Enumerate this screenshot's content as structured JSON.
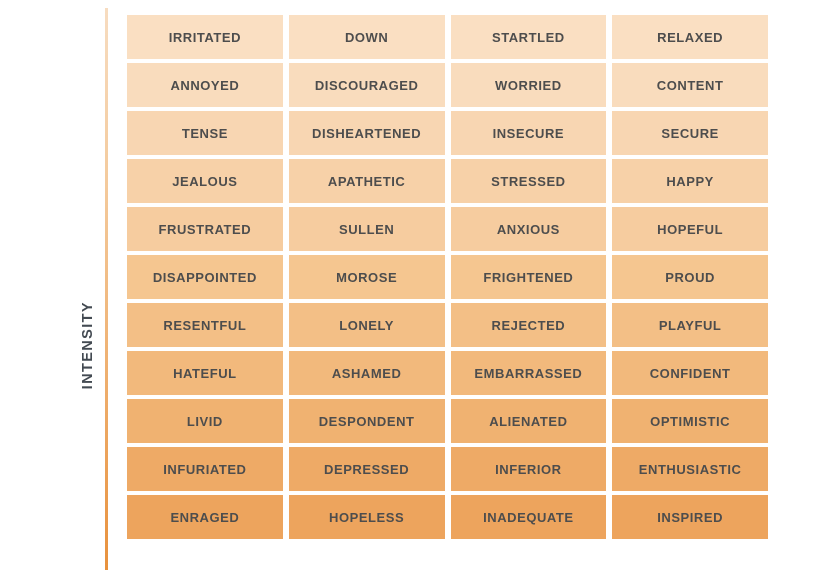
{
  "axis": {
    "label": "INTENSITY",
    "label_color": "#434a52",
    "line_top_color": "#f7dcc0",
    "line_bottom_color": "#e8913d"
  },
  "theme": {
    "text_color": "#4d4d4d",
    "background": "#ffffff"
  },
  "chart_data": {
    "type": "table",
    "title": "",
    "xlabel": "",
    "ylabel": "INTENSITY",
    "legend": [],
    "grid": false,
    "description": "Emotion intensity grid: four columns of feeling words ordered from lowest intensity (top, lightest shade) to highest intensity (bottom, most saturated orange).",
    "columns": 4,
    "rows": 11,
    "row_colors": [
      "#fadfc2",
      "#f9dcbd",
      "#f8d6b2",
      "#f7d1a8",
      "#f6cc9f",
      "#f5c690",
      "#f3bf86",
      "#f2b97c",
      "#f0b271",
      "#eeaa66",
      "#eda45d"
    ],
    "series": [
      {
        "name": "column-1",
        "values": [
          "IRRITATED",
          "ANNOYED",
          "TENSE",
          "JEALOUS",
          "FRUSTRATED",
          "DISAPPOINTED",
          "RESENTFUL",
          "HATEFUL",
          "LIVID",
          "INFURIATED",
          "ENRAGED"
        ]
      },
      {
        "name": "column-2",
        "values": [
          "DOWN",
          "DISCOURAGED",
          "DISHEARTENED",
          "APATHETIC",
          "SULLEN",
          "MOROSE",
          "LONELY",
          "ASHAMED",
          "DESPONDENT",
          "DEPRESSED",
          "HOPELESS"
        ]
      },
      {
        "name": "column-3",
        "values": [
          "STARTLED",
          "WORRIED",
          "INSECURE",
          "STRESSED",
          "ANXIOUS",
          "FRIGHTENED",
          "REJECTED",
          "EMBARRASSED",
          "ALIENATED",
          "INFERIOR",
          "INADEQUATE"
        ]
      },
      {
        "name": "column-4",
        "values": [
          "RELAXED",
          "CONTENT",
          "SECURE",
          "HAPPY",
          "HOPEFUL",
          "PROUD",
          "PLAYFUL",
          "CONFIDENT",
          "OPTIMISTIC",
          "ENTHUSIASTIC",
          "INSPIRED"
        ]
      }
    ],
    "rows_data": [
      [
        "IRRITATED",
        "DOWN",
        "STARTLED",
        "RELAXED"
      ],
      [
        "ANNOYED",
        "DISCOURAGED",
        "WORRIED",
        "CONTENT"
      ],
      [
        "TENSE",
        "DISHEARTENED",
        "INSECURE",
        "SECURE"
      ],
      [
        "JEALOUS",
        "APATHETIC",
        "STRESSED",
        "HAPPY"
      ],
      [
        "FRUSTRATED",
        "SULLEN",
        "ANXIOUS",
        "HOPEFUL"
      ],
      [
        "DISAPPOINTED",
        "MOROSE",
        "FRIGHTENED",
        "PROUD"
      ],
      [
        "RESENTFUL",
        "LONELY",
        "REJECTED",
        "PLAYFUL"
      ],
      [
        "HATEFUL",
        "ASHAMED",
        "EMBARRASSED",
        "CONFIDENT"
      ],
      [
        "LIVID",
        "DESPONDENT",
        "ALIENATED",
        "OPTIMISTIC"
      ],
      [
        "INFURIATED",
        "DEPRESSED",
        "INFERIOR",
        "ENTHUSIASTIC"
      ],
      [
        "ENRAGED",
        "HOPELESS",
        "INADEQUATE",
        "INSPIRED"
      ]
    ]
  }
}
